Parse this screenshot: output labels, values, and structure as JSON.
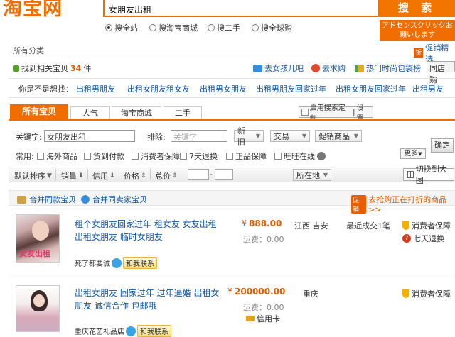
{
  "header": {
    "logo": "淘宝网",
    "search_value": "女朋友出租",
    "search_button": "搜 索",
    "ad_text": "アドセンスクリックお願いします",
    "scopes": [
      {
        "label": "搜全站",
        "selected": true
      },
      {
        "label": "搜淘宝商城",
        "selected": false
      },
      {
        "label": "搜二手",
        "selected": false
      },
      {
        "label": "搜全球购",
        "selected": false
      }
    ]
  },
  "breadcrumb": {
    "all_categories": "所有分类",
    "promo": "促销精选"
  },
  "found": {
    "prefix": "找到相关宝贝",
    "count": "34",
    "suffix": "件",
    "links": [
      "去女孩儿吧",
      "去求购",
      "热门时尚包袋榜"
    ],
    "same_city": "同店购"
  },
  "suggestions": {
    "label": "你是不是想找：",
    "items": [
      "出租男朋友",
      "出租女朋友租女友",
      "出租男女朋友",
      "出租男朋友回家过年",
      "出租女朋友回家过年",
      "出租男友"
    ]
  },
  "tabs": {
    "items": [
      "所有宝贝",
      "人气",
      "淘宝商城",
      "二手"
    ],
    "custom": "启用搜索定制",
    "settings": "设置"
  },
  "filter": {
    "keyword_label": "关键字:",
    "keyword_value": "女朋友出租",
    "exclude_label": "排除:",
    "exclude_placeholder": "关键字",
    "condition": "新旧",
    "trade": "交易",
    "promo": "促销商品",
    "confirm": "确定",
    "common_label": "常用:",
    "options": [
      "海外商品",
      "货到付款",
      "消费者保障",
      "7天退换",
      "正品保障",
      "旺旺在线"
    ],
    "more": "更多"
  },
  "sort": {
    "items": [
      "默认排序",
      "销量",
      "信用",
      "价格",
      "总价"
    ],
    "location": "所在地",
    "big_image": "切换到大图"
  },
  "merge": {
    "same_items": "合并同款宝贝",
    "same_sellers": "合并同卖家宝贝",
    "promo_badge": "促销",
    "promo_text": "去抢购正在打折的商品>>"
  },
  "items": [
    {
      "title": "租个女朋友回家过年 租女友 女友出租 出租女朋友 临时女朋友",
      "title_lines": [
        "租个女朋友回家过年 租女友 女友出租",
        "出租女朋友 临时女朋友"
      ],
      "price": "888.00",
      "shipping": "运费：0.00",
      "location": "江西 吉安",
      "recent": "最近成交1笔",
      "seller": "死了都要诚",
      "contact": "和我联系",
      "guarantees": [
        "消费者保障",
        "七天退换"
      ],
      "thumb_caption": "女友出租"
    },
    {
      "title": "出租女朋友 回家过年 过年逼婚 出租女友 朋友 诚信合作 包邮哦",
      "title_lines": [
        "出租女朋友 回家过年 过年逼婚 出租女",
        "朋友 诚信合作 包邮哦"
      ],
      "price": "200000.00",
      "shipping": "运费：0.00",
      "location": "重庆",
      "credit": "信用卡",
      "seller": "重庆花艺礼品店",
      "contact": "和我联系",
      "guarantees": [
        "消费者保障"
      ]
    }
  ]
}
